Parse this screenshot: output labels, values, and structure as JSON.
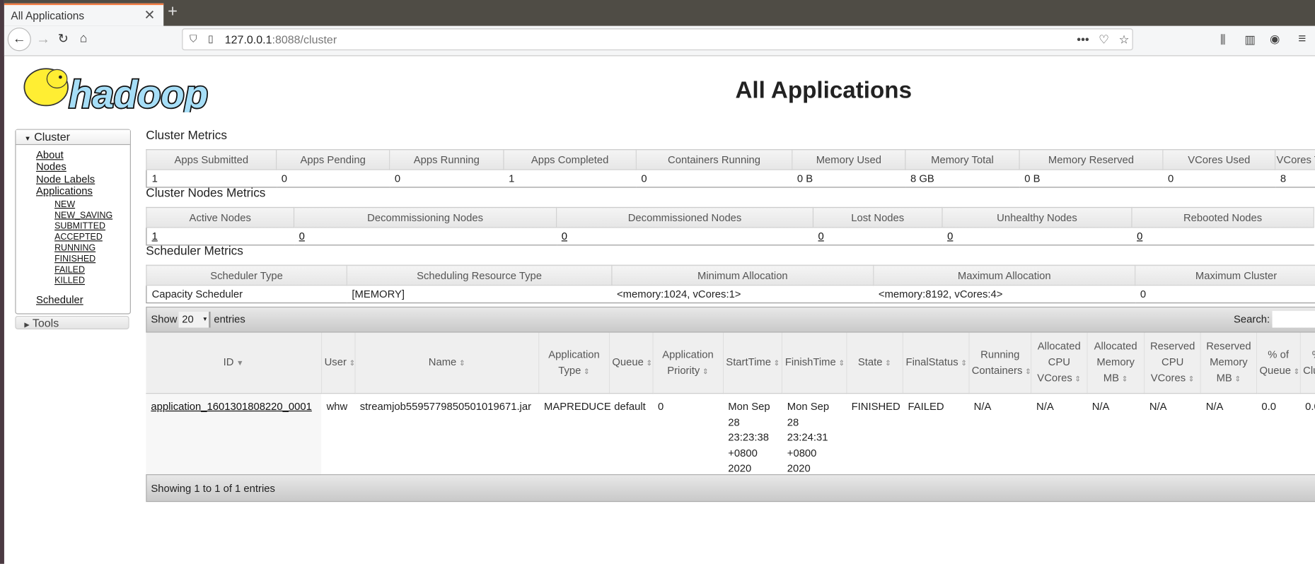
{
  "browser": {
    "tab_title": "All Applications",
    "url_host": "127.0.0.1",
    "url_path": ":8088/cluster"
  },
  "page": {
    "title": "All Applications",
    "logo_text": "hadoop"
  },
  "sidebar": {
    "cluster_label": "Cluster",
    "items": [
      "About",
      "Nodes",
      "Node Labels",
      "Applications"
    ],
    "app_states": [
      "NEW",
      "NEW_SAVING",
      "SUBMITTED",
      "ACCEPTED",
      "RUNNING",
      "FINISHED",
      "FAILED",
      "KILLED"
    ],
    "scheduler": "Scheduler",
    "tools_label": "Tools"
  },
  "cluster_metrics": {
    "title": "Cluster Metrics",
    "headers": [
      "Apps Submitted",
      "Apps Pending",
      "Apps Running",
      "Apps Completed",
      "Containers Running",
      "Memory Used",
      "Memory Total",
      "Memory Reserved",
      "VCores Used",
      "VCores Total"
    ],
    "values": [
      "1",
      "0",
      "0",
      "1",
      "0",
      "0 B",
      "8 GB",
      "0 B",
      "0",
      "8"
    ]
  },
  "nodes_metrics": {
    "title": "Cluster Nodes Metrics",
    "headers": [
      "Active Nodes",
      "Decommissioning Nodes",
      "Decommissioned Nodes",
      "Lost Nodes",
      "Unhealthy Nodes",
      "Rebooted Nodes"
    ],
    "values": [
      "1",
      "0",
      "0",
      "0",
      "0",
      "0"
    ]
  },
  "scheduler_metrics": {
    "title": "Scheduler Metrics",
    "headers": [
      "Scheduler Type",
      "Scheduling Resource Type",
      "Minimum Allocation",
      "Maximum Allocation",
      "Maximum Cluster"
    ],
    "values": [
      "Capacity Scheduler",
      "[MEMORY]",
      "<memory:1024, vCores:1>",
      "<memory:8192, vCores:4>",
      "0"
    ]
  },
  "apps": {
    "show_label": "Show",
    "page_size": "20",
    "entries_label": "entries",
    "search_label": "Search:",
    "search_value": "",
    "headers": [
      "ID",
      "User",
      "Name",
      "Application Type",
      "Queue",
      "Application Priority",
      "StartTime",
      "FinishTime",
      "State",
      "FinalStatus",
      "Running Containers",
      "Allocated CPU VCores",
      "Allocated Memory MB",
      "Reserved CPU VCores",
      "Reserved Memory MB",
      "% of Queue",
      "% of Cluster"
    ],
    "rows": [
      [
        "application_1601301808220_0001",
        "whw",
        "streamjob5595779850501019671.jar",
        "MAPREDUCE",
        "default",
        "0",
        "Mon Sep 28 23:23:38 +0800 2020",
        "Mon Sep 28 23:24:31 +0800 2020",
        "FINISHED",
        "FAILED",
        "N/A",
        "N/A",
        "N/A",
        "N/A",
        "N/A",
        "0.0",
        "0.0"
      ]
    ],
    "footer": "Showing 1 to 1 of 1 entries"
  }
}
